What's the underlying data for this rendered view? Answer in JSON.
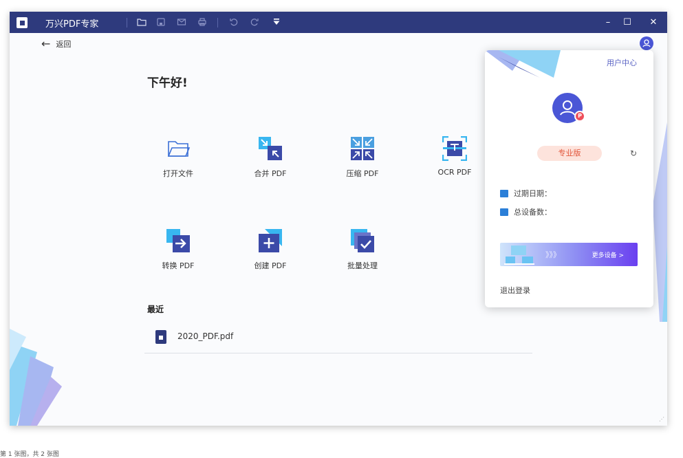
{
  "titlebar": {
    "app_title": "万兴PDF专家",
    "icons": [
      "folder-icon",
      "save-icon",
      "mail-icon",
      "print-icon",
      "undo-icon",
      "redo-icon",
      "dropdown-icon"
    ],
    "window_controls": {
      "minimize": "–",
      "maximize": "☐",
      "close": "✕"
    }
  },
  "nav": {
    "back_arrow": "←",
    "back_label": "返回"
  },
  "home": {
    "greeting": "下午好!",
    "tools": [
      {
        "label": "打开文件",
        "icon": "open-folder-icon"
      },
      {
        "label": "合并 PDF",
        "icon": "merge-pdf-icon"
      },
      {
        "label": "压缩 PDF",
        "icon": "compress-pdf-icon"
      },
      {
        "label": "OCR PDF",
        "icon": "ocr-pdf-icon"
      },
      {
        "label": "转换 PDF",
        "icon": "convert-pdf-icon"
      },
      {
        "label": "创建 PDF",
        "icon": "create-pdf-icon"
      },
      {
        "label": "批量处理",
        "icon": "batch-process-icon"
      }
    ],
    "recent_title": "最近",
    "recent_files": [
      {
        "name": "2020_PDF.pdf"
      }
    ]
  },
  "popup": {
    "user_center": "用户中心",
    "avatar_badge": "P",
    "plan": "专业版",
    "refresh_icon": "↻",
    "expiry_label": "过期日期：",
    "devices_label": "总设备数：",
    "banner_arrows": "》》》",
    "more_devices": "更多设备 >",
    "logout": "退出登录"
  },
  "caption": "第 1 张图，共 2 张图",
  "colors": {
    "titlebar": "#2e3a7d",
    "accent": "#4a56d6",
    "plan_bg": "#fde3dc",
    "plan_text": "#e2553a"
  }
}
